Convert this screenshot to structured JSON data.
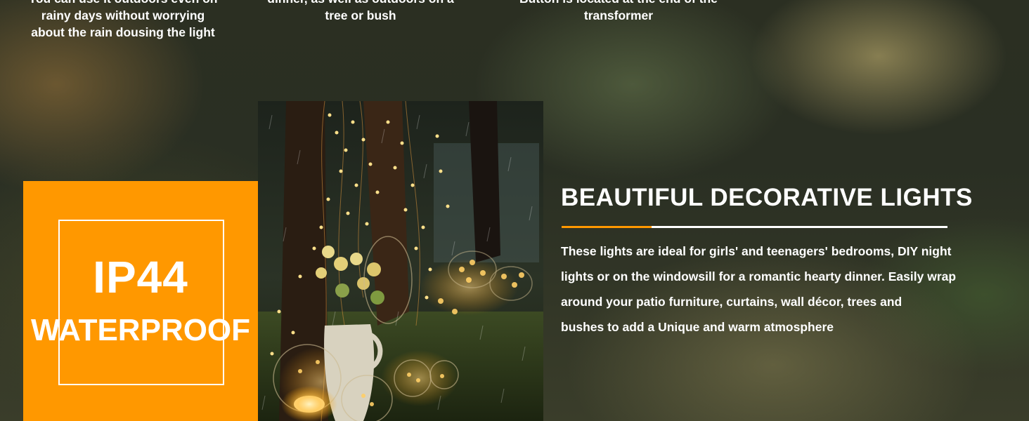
{
  "captions": [
    {
      "lines": [
        "You can use it outdoors even on",
        "rainy days without worrying",
        "about the rain dousing the light"
      ]
    },
    {
      "lines": [
        "dinner, as well as outdoors on a",
        "tree or bush"
      ]
    },
    {
      "lines": [
        "Button is located at the end of the",
        "transformer"
      ]
    }
  ],
  "badge": {
    "code": "IP44",
    "label": "WATERPROOF",
    "color": "#ff9800"
  },
  "photo": {
    "subject": "fairy-lights-in-rain-photo"
  },
  "feature": {
    "title": "BEAUTIFUL DECORATIVE LIGHTS",
    "accent_color": "#ff9800",
    "body_lines": [
      "These lights are ideal for girls' and teenagers' bedrooms, DIY night",
      "lights or on the windowsill for a romantic hearty dinner. Easily wrap",
      "around your patio furniture, curtains, wall décor, trees and",
      "bushes to add a Unique and warm atmosphere"
    ]
  }
}
